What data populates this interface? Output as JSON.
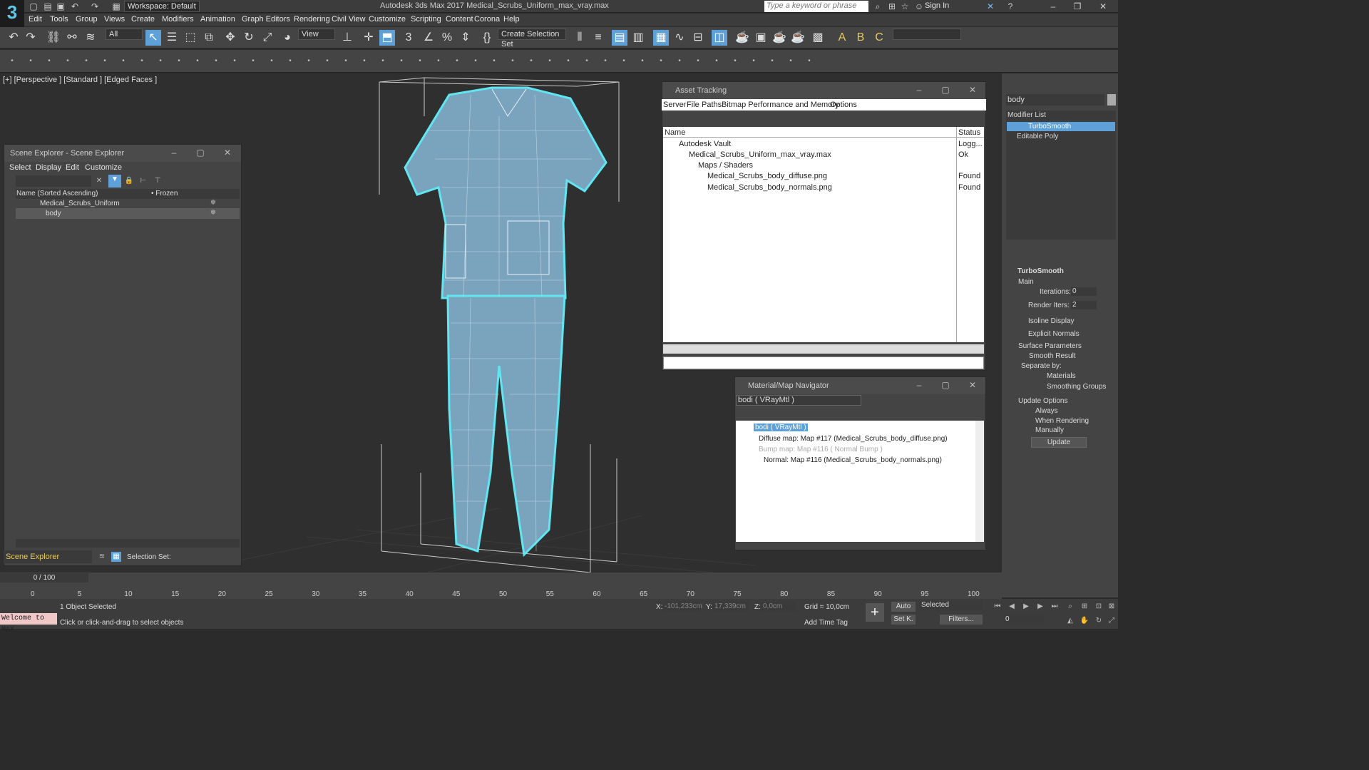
{
  "titlebar": {
    "logo": "3",
    "workspace": "Workspace: Default",
    "app_title": "Autodesk 3ds Max 2017     Medical_Scrubs_Uniform_max_vray.max",
    "search_placeholder": "Type a keyword or phrase",
    "sign_in": "Sign In"
  },
  "menus": [
    "Edit",
    "Tools",
    "Group",
    "Views",
    "Create",
    "Modifiers",
    "Animation",
    "Graph Editors",
    "Rendering",
    "Civil View",
    "Customize",
    "Scripting",
    "Content",
    "Corona",
    "Help"
  ],
  "toolbar": {
    "selection_filter": "All",
    "ref_coord": "View",
    "selection_set": "Create Selection Set"
  },
  "viewport": {
    "label": "[+] [Perspective ] [Standard ] [Edged Faces ]"
  },
  "scene_explorer": {
    "title": "Scene Explorer - Scene Explorer",
    "menus": [
      "Select",
      "Display",
      "Edit",
      "Customize"
    ],
    "col_name": "Name (Sorted Ascending)",
    "col_frozen": "• Frozen",
    "rows": [
      "Medical_Scrubs_Uniform",
      "body"
    ],
    "footer_label": "Scene Explorer",
    "selection_set_label": "Selection Set:"
  },
  "asset_tracking": {
    "title": "Asset Tracking",
    "menus": [
      "Server",
      "File",
      "Paths",
      "Bitmap Performance and Memory",
      "Options"
    ],
    "col_name": "Name",
    "col_status": "Status",
    "rows": [
      {
        "name": "Autodesk Vault",
        "status": "Logg..."
      },
      {
        "name": "Medical_Scrubs_Uniform_max_vray.max",
        "status": "Ok"
      },
      {
        "name": "Maps / Shaders",
        "status": ""
      },
      {
        "name": "Medical_Scrubs_body_diffuse.png",
        "status": "Found"
      },
      {
        "name": "Medical_Scrubs_body_normals.png",
        "status": "Found"
      }
    ]
  },
  "material_nav": {
    "title": "Material/Map Navigator",
    "field": "bodi  ( VRayMtl )",
    "root": "bodi  ( VRayMtl )",
    "items": [
      "Diffuse map: Map #117 (Medical_Scrubs_body_diffuse.png)",
      "Bump map: Map #116  ( Normal Bump )",
      "Normal: Map #116 (Medical_Scrubs_body_normals.png)"
    ]
  },
  "command_panel": {
    "object_name": "body",
    "modifier_list": "Modifier List",
    "stack": [
      "TurboSmooth",
      "Editable Poly"
    ],
    "rollout_title": "TurboSmooth",
    "main": "Main",
    "iterations_label": "Iterations:",
    "iterations_value": "0",
    "render_iters_label": "Render Iters:",
    "render_iters_value": "2",
    "isoline": "Isoline Display",
    "explicit_normals": "Explicit Normals",
    "surface_params": "Surface Parameters",
    "smooth_result": "Smooth Result",
    "separate_by": "Separate by:",
    "materials": "Materials",
    "smoothing_groups": "Smoothing Groups",
    "update_options": "Update Options",
    "always": "Always",
    "when_rendering": "When Rendering",
    "manually": "Manually",
    "update_button": "Update"
  },
  "timeline": {
    "frame_counter": "0 / 100",
    "ticks": [
      "0",
      "5",
      "10",
      "15",
      "20",
      "25",
      "30",
      "35",
      "40",
      "45",
      "50",
      "55",
      "60",
      "65",
      "70",
      "75",
      "80",
      "85",
      "90",
      "95",
      "100"
    ]
  },
  "statusbar": {
    "maxscript": "Welcome to MAX",
    "selected": "1 Object Selected",
    "prompt": "Click or click-and-drag to select objects",
    "x_label": "X:",
    "x_value": "-101,233cm",
    "y_label": "Y:",
    "y_value": "17,339cm",
    "z_label": "Z:",
    "z_value": "0,0cm",
    "grid": "Grid = 10,0cm",
    "add_time_tag": "Add Time Tag",
    "auto": "Auto",
    "set_key": "Set K.",
    "selected_dd": "Selected",
    "filters": "Filters...",
    "frame": "0"
  },
  "colors": {
    "accent": "#5ea0d8",
    "garment": "#7aa3bd",
    "selection": "#5fe6f0"
  }
}
